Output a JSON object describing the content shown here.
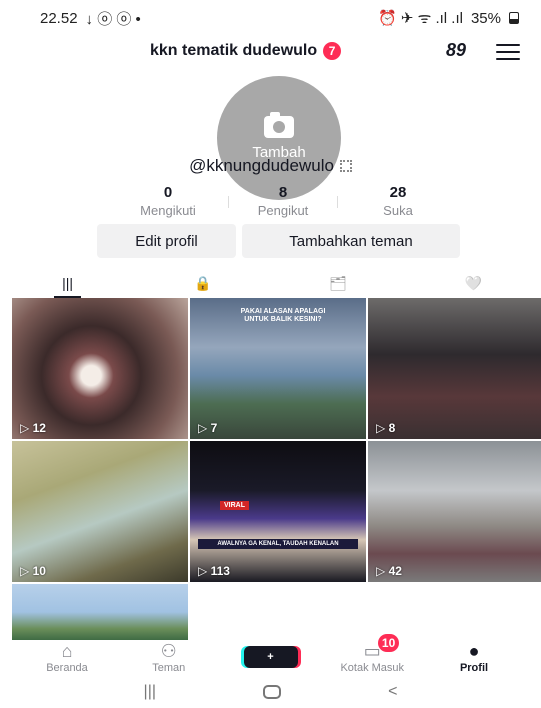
{
  "status": {
    "time": "22.52",
    "left_icons": "↓ ⓞ ⓞ •",
    "right_icons": "⏰ ✈ ᯤ .ıl .ıl",
    "battery": "35%"
  },
  "header": {
    "title": "kkn tematik dudewulo",
    "badge": "7",
    "icon_text": "89"
  },
  "profile": {
    "avatar_label": "Tambah",
    "username": "@kknungdudewulo",
    "stats": [
      {
        "num": "0",
        "label": "Mengikuti"
      },
      {
        "num": "8",
        "label": "Pengikut"
      },
      {
        "num": "28",
        "label": "Suka"
      }
    ],
    "buttons": {
      "edit": "Edit profil",
      "add": "Tambahkan teman"
    }
  },
  "tabs": [
    "|||",
    "🔒",
    "🗂",
    "🤍"
  ],
  "grid": {
    "views": [
      "12",
      "7",
      "8",
      "10",
      "113",
      "42"
    ],
    "cell2_caption": "PAKAI ALASAN APALAGI UNTUK BALIK KESINI?",
    "cell5_label": "VIRAL",
    "cell5_news": "AWALNYA GA KENAL, TAUDAH KENALAN"
  },
  "bottom_nav": {
    "home": "Beranda",
    "friends": "Teman",
    "plus": "+",
    "inbox": "Kotak Masuk",
    "inbox_badge": "10",
    "profile": "Profil"
  },
  "sys_nav": {
    "recent": "|||",
    "back": "<"
  },
  "colors": {
    "accent_red": "#fe2c55",
    "accent_cyan": "#25f4ee",
    "text": "#161823"
  }
}
